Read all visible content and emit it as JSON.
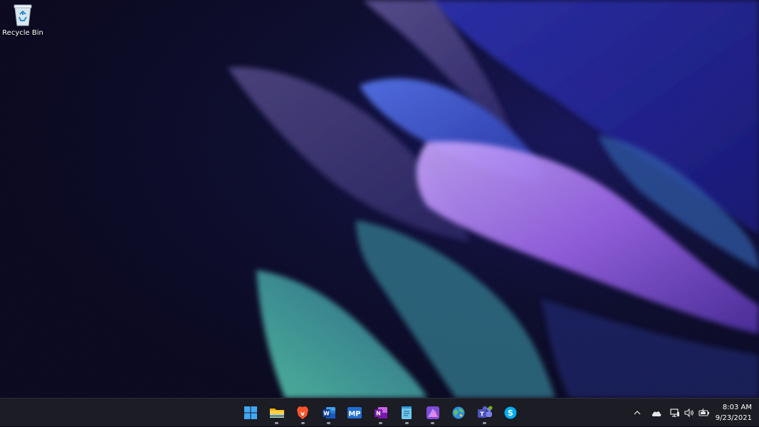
{
  "desktop": {
    "icons": [
      {
        "label": "Recycle Bin",
        "icon": "recycle-bin-icon"
      }
    ]
  },
  "taskbar": {
    "apps": [
      {
        "name": "start",
        "icon": "windows-start-icon",
        "running": false
      },
      {
        "name": "file-explorer",
        "icon": "folder-icon",
        "running": true
      },
      {
        "name": "brave",
        "icon": "brave-lion-icon",
        "running": true
      },
      {
        "name": "word",
        "icon": "word-icon",
        "running": true
      },
      {
        "name": "mp",
        "icon": "mp-icon",
        "running": false,
        "badge_text": "MP"
      },
      {
        "name": "onenote",
        "icon": "onenote-icon",
        "running": true
      },
      {
        "name": "notepad",
        "icon": "notepad-icon",
        "running": true
      },
      {
        "name": "affinity",
        "icon": "affinity-icon",
        "running": true
      },
      {
        "name": "maps",
        "icon": "globe-icon",
        "running": false
      },
      {
        "name": "teams",
        "icon": "teams-icon",
        "running": true
      },
      {
        "name": "skype",
        "icon": "skype-icon",
        "running": false
      }
    ],
    "tray": {
      "icons": [
        "chevron-up-icon",
        "onedrive-cloud-icon",
        "network-icon",
        "volume-icon",
        "battery-icon"
      ],
      "time": "8:03 AM",
      "date": "9/23/2021"
    }
  },
  "colors": {
    "taskbar_bg": "#1c1c24",
    "word_blue": "#2b579a",
    "onenote_purple": "#7719aa",
    "brave_orange": "#fb542b",
    "skype_blue": "#00aff0",
    "teams_purple": "#5b5fc7"
  }
}
